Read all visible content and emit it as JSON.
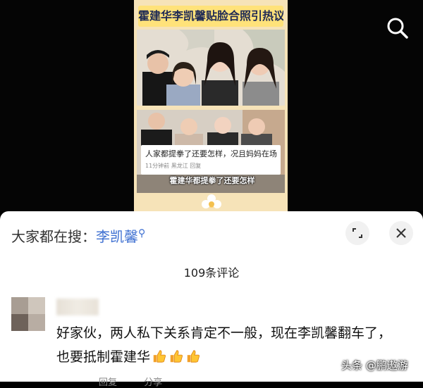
{
  "video": {
    "poster_title": "霍建华李凯馨贴脸合照引热议",
    "caption": "人家都提拳了还要怎样，况且妈妈在场",
    "caption_meta": "11分钟前  黑龙江  回复",
    "poster_subtitle": "霍建华都提拳了还要怎样"
  },
  "search": {
    "icon": "search-icon"
  },
  "panel": {
    "hot_search_prefix": "大家都在搜：",
    "hot_search_keyword": "李凯馨",
    "comment_count_title": "109条评论",
    "expand_icon": "expand-icon",
    "close_icon": "close-icon"
  },
  "comment": {
    "text": "好家伙，两人私下关系肯定不一般，现在李凯馨翻车了，也要抵制霍建华",
    "emoji": [
      "thumbs-up",
      "thumbs-up",
      "thumbs-up"
    ],
    "reply_label": "回复",
    "share_label": "分享"
  },
  "watermark": "头条 @鹏遨游",
  "colors": {
    "keyword": "#3d6fd1",
    "title_bg": "#ffe27a",
    "poster_bg": "#f6e3b8"
  }
}
